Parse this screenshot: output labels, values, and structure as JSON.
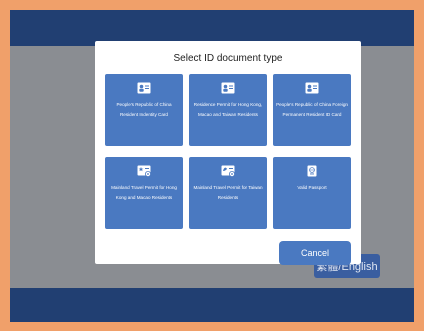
{
  "modal": {
    "title": "Select ID document type",
    "options": [
      {
        "label": "People's Republic of China Resident Indentity Card",
        "icon": "id-card-icon"
      },
      {
        "label": "Residence Permit for Hong Kong, Macao and Taiwan Residents",
        "icon": "id-card-icon"
      },
      {
        "label": "People's Republic of China Foreign Permanent Resident ID Card",
        "icon": "id-card-icon"
      },
      {
        "label": "Mainland Travel Permit for Hong Kong and Macao Residents",
        "icon": "travel-permit-icon"
      },
      {
        "label": "Mainland Travel Permit for Taiwan Residents",
        "icon": "travel-permit-icon"
      },
      {
        "label": "Valid Passport",
        "icon": "passport-icon"
      }
    ],
    "cancel_label": "Cancel"
  },
  "footer": {
    "language_label": "繁體/English"
  },
  "colors": {
    "bezel": "#f0a06a",
    "bar": "#213f72",
    "overlay": "#8a8d92",
    "card": "#4a79c1"
  }
}
